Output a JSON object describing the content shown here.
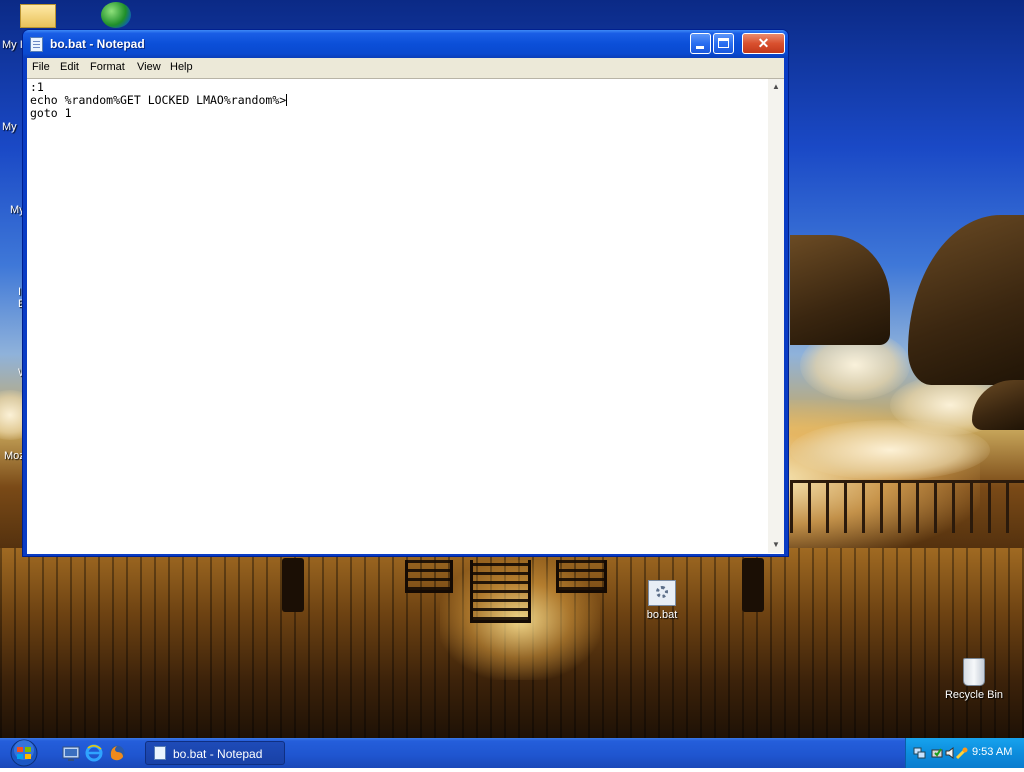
{
  "window": {
    "title": "bo.bat - Notepad",
    "buttons": {
      "minimize": "minimize",
      "maximize": "maximize",
      "close": "close"
    }
  },
  "menu": {
    "items": [
      "File",
      "Edit",
      "Format",
      "View",
      "Help"
    ]
  },
  "editor": {
    "lines": [
      ":1",
      "echo %random%GET LOCKED LMAO%random%>",
      "goto 1"
    ]
  },
  "desktop": {
    "icons": [
      {
        "label": "bo.bat",
        "icon": "batch-file-icon"
      },
      {
        "label": "Recycle Bin",
        "icon": "recycle-bin-icon"
      }
    ],
    "partial_labels": [
      "My I",
      "My",
      "My",
      "I",
      "E",
      "W",
      "Moz"
    ]
  },
  "taskbar": {
    "start": "start-orb",
    "quick_launch": [
      "show-desktop-icon",
      "internet-explorer-icon",
      "firefox-icon"
    ],
    "task_button": "bo.bat - Notepad",
    "tray_icons": [
      "network-icon",
      "safely-remove-icon",
      "volume-icon",
      "tool-icon"
    ],
    "clock": "9:53 AM"
  },
  "colors": {
    "titlebar": "#0b4fd8",
    "taskbar": "#245edb",
    "tray": "#0d8ddd",
    "close_button": "#d9502e"
  }
}
